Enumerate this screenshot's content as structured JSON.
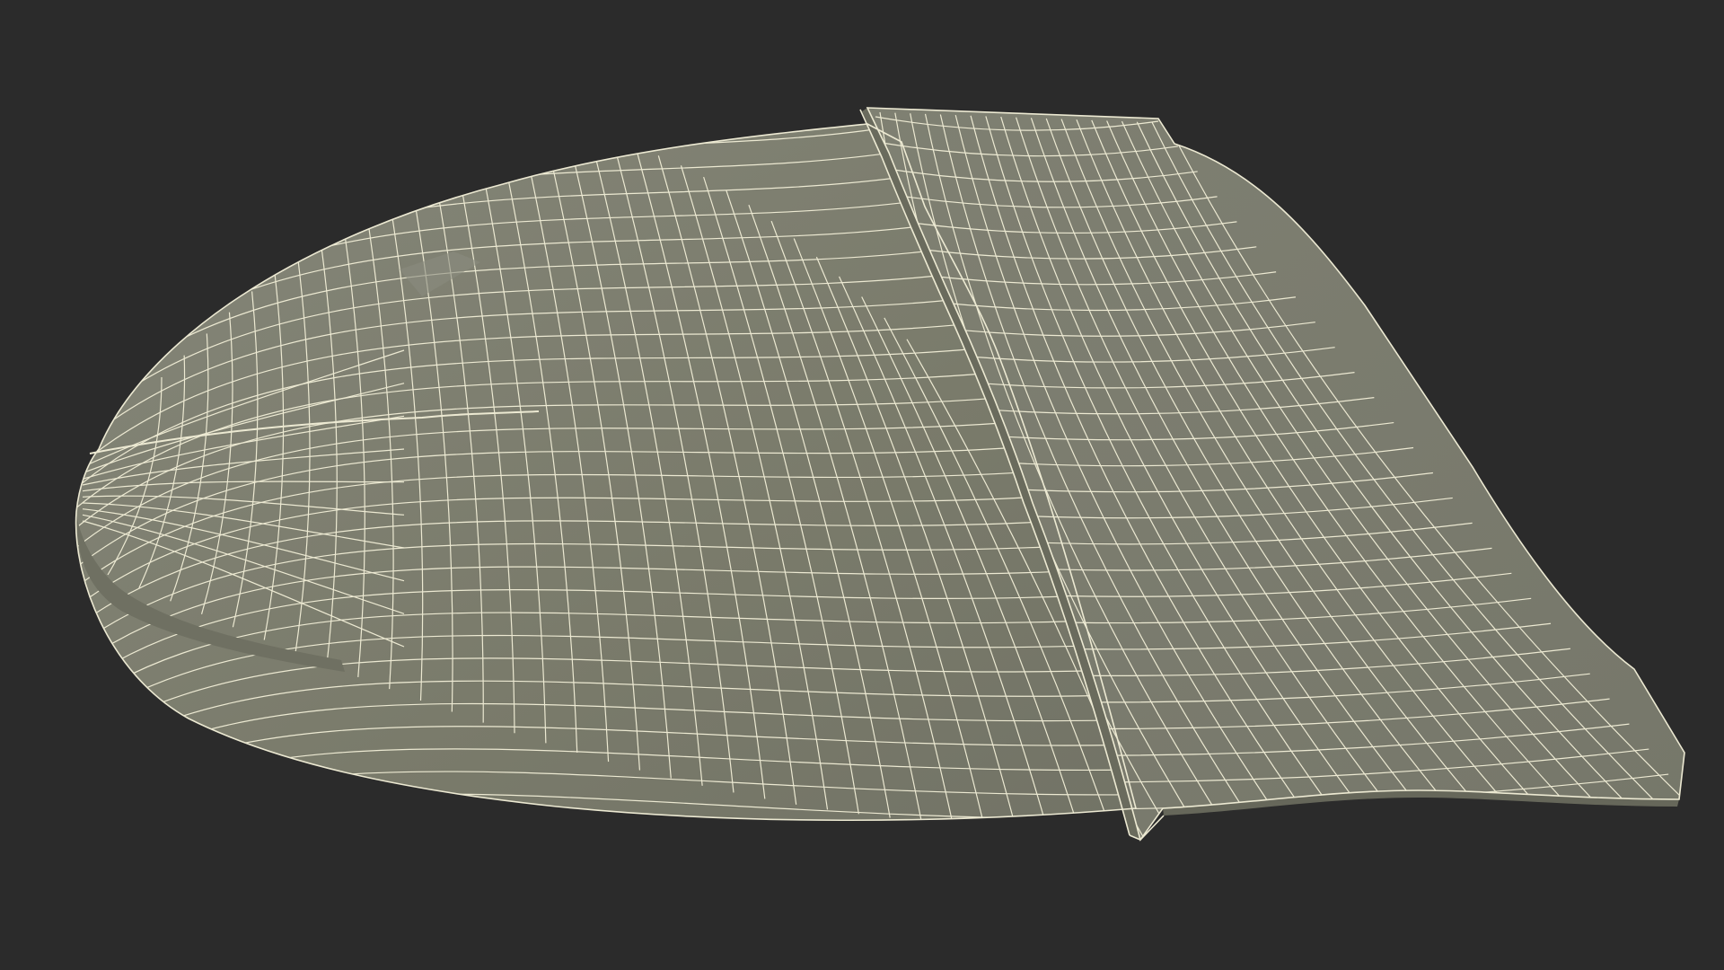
{
  "scene": {
    "background_color": "#2b2b2b",
    "surface_color": "#7a7b6b",
    "surface_shadow_color": "#6c6d5f",
    "surface_light_color": "#86877a",
    "wire_color": "#ece9d2",
    "object_kind": "wireframe-quad-mesh"
  }
}
